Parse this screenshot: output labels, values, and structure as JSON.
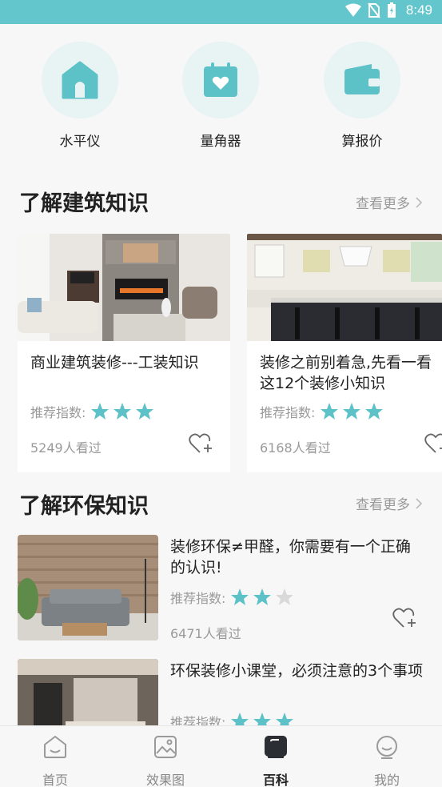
{
  "status": {
    "time": "8:49"
  },
  "tools": [
    {
      "label": "水平仪",
      "icon": "house-icon"
    },
    {
      "label": "量角器",
      "icon": "calendar-heart-icon"
    },
    {
      "label": "算报价",
      "icon": "wallet-icon"
    }
  ],
  "section1": {
    "title": "了解建筑知识",
    "more": "查看更多",
    "cards": [
      {
        "title": "商业建筑装修---工装知识",
        "rating_label": "推荐指数:",
        "stars": 3,
        "views": "5249人看过"
      },
      {
        "title": "装修之前别着急,先看一看这12个装修小知识",
        "rating_label": "推荐指数:",
        "stars": 3,
        "views": "6168人看过"
      }
    ]
  },
  "section2": {
    "title": "了解环保知识",
    "more": "查看更多",
    "items": [
      {
        "title": "装修环保≠甲醛，你需要有一个正确的认识!",
        "rating_label": "推荐指数:",
        "stars": 2,
        "views": "6471人看过"
      },
      {
        "title": "环保装修小课堂，必须注意的3个事项",
        "rating_label": "推荐指数:",
        "stars": 3,
        "views": ""
      }
    ]
  },
  "tabs": [
    {
      "label": "首页",
      "icon": "home-icon",
      "active": false
    },
    {
      "label": "效果图",
      "icon": "image-icon",
      "active": false
    },
    {
      "label": "百科",
      "icon": "encyclopedia-icon",
      "active": true
    },
    {
      "label": "我的",
      "icon": "profile-icon",
      "active": false
    }
  ],
  "colors": {
    "accent": "#5cc2c8",
    "status_bar": "#62c6cc",
    "star_off": "#d9d9d9"
  }
}
